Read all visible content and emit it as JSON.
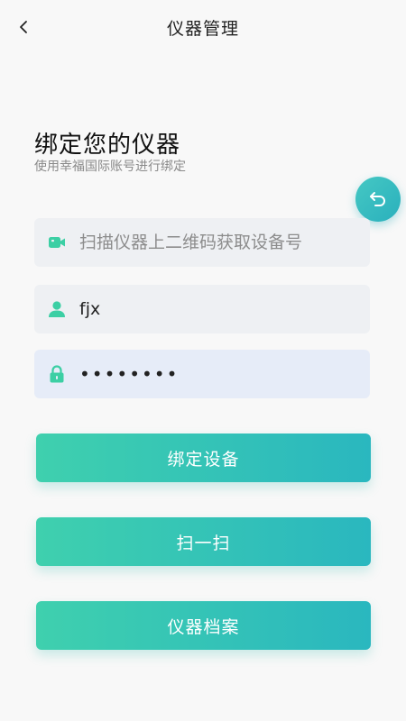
{
  "header": {
    "title": "仪器管理",
    "back_icon": "chevron-left-icon"
  },
  "intro": {
    "heading": "绑定您的仪器",
    "subheading": "使用幸福国际账号进行绑定"
  },
  "fab": {
    "icon": "undo-icon"
  },
  "form": {
    "scan": {
      "icon": "video-camera-icon",
      "value": "",
      "placeholder": "扫描仪器上二维码获取设备号"
    },
    "username": {
      "icon": "user-icon",
      "value": "fjx",
      "placeholder": ""
    },
    "password": {
      "icon": "lock-icon",
      "value": "••••••••"
    }
  },
  "buttons": {
    "bind_label": "绑定设备",
    "scan_label": "扫一扫",
    "archive_label": "仪器档案"
  },
  "colors": {
    "accent_start": "#3fd0ae",
    "accent_end": "#2ab7bf",
    "icon_green": "#3ccfa4"
  }
}
